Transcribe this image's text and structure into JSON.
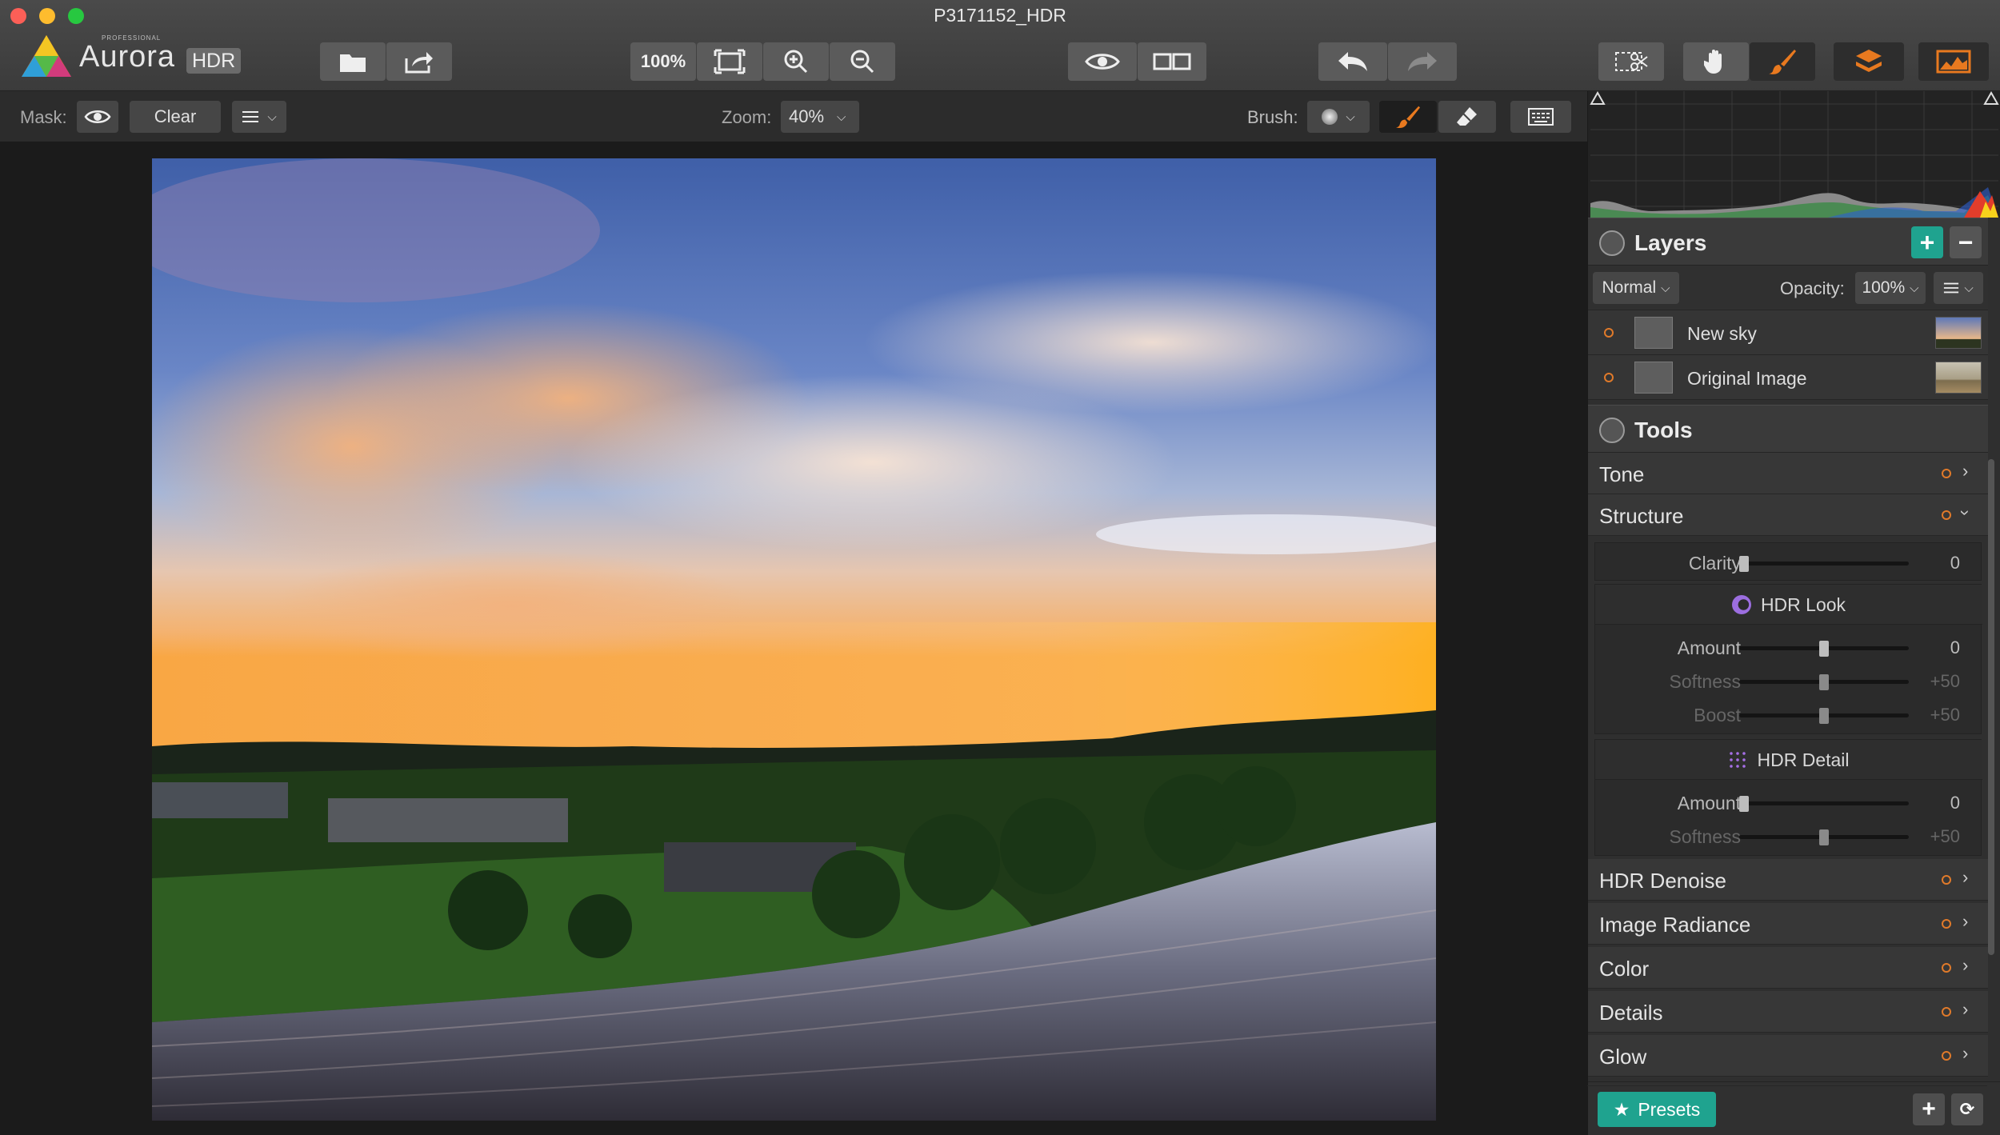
{
  "window": {
    "title": "P3171152_HDR"
  },
  "logo": {
    "small": "PROFESSIONAL",
    "word": "Aurora",
    "badge": "HDR"
  },
  "toolbar": {
    "zoom_100": "100%",
    "accent": "#e8791f"
  },
  "subbar": {
    "mask_label": "Mask:",
    "clear_label": "Clear",
    "zoom_label": "Zoom:",
    "zoom_value": "40%",
    "brush_label": "Brush:"
  },
  "layers": {
    "title": "Layers",
    "blend_mode": "Normal",
    "opacity_label": "Opacity:",
    "opacity_value": "100%",
    "items": [
      {
        "name": "New sky"
      },
      {
        "name": "Original Image"
      }
    ]
  },
  "tools": {
    "title": "Tools",
    "tone": "Tone",
    "structure": "Structure",
    "clarity": {
      "label": "Clarity",
      "value": "0",
      "level": 0
    },
    "hdr_look": {
      "title": "HDR Look",
      "amount": {
        "label": "Amount",
        "value": "0",
        "level": 0.5
      },
      "softness": {
        "label": "Softness",
        "value": "+50",
        "level": 0.5
      },
      "boost": {
        "label": "Boost",
        "value": "+50",
        "level": 0.5
      }
    },
    "hdr_detail": {
      "title": "HDR Detail",
      "amount": {
        "label": "Amount",
        "value": "0",
        "level": 0
      },
      "softness": {
        "label": "Softness",
        "value": "+50",
        "level": 0.5
      }
    },
    "rest": [
      "HDR Denoise",
      "Image Radiance",
      "Color",
      "Details",
      "Glow"
    ]
  },
  "presets": {
    "label": "Presets"
  },
  "colors": {
    "teal": "#1fa38f",
    "orange": "#e8791f"
  }
}
